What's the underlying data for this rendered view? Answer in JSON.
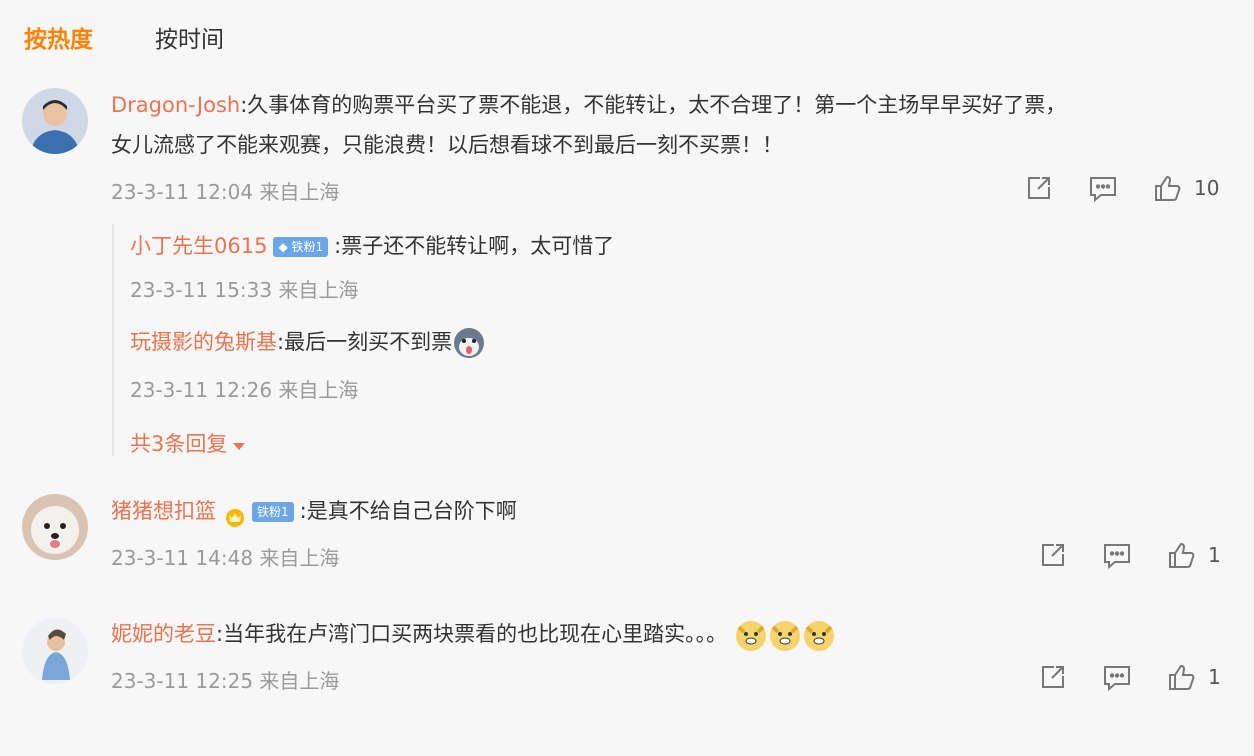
{
  "tabs": {
    "hot": "按热度",
    "time": "按时间"
  },
  "comments": [
    {
      "user": "Dragon-Josh",
      "text_line1": ":久事体育的购票平台买了票不能退，不能转让，太不合理了！第一个主场早早买好了票，",
      "text_line2": "女儿流感了不能来观赛，只能浪费！以后想看球不到最后一刻不买票！！",
      "time": "23-3-11 12:04 来自上海",
      "likes": "10"
    },
    {
      "user": "猪猪想扣篮",
      "badge": "铁粉1",
      "text": ":是真不给自己台阶下啊",
      "time": "23-3-11 14:48 来自上海",
      "likes": "1"
    },
    {
      "user": "妮妮的老豆",
      "text": ":当年我在卢湾门口买两块票看的也比现在心里踏实。。。",
      "emojis": [
        "doge-emoji",
        "doge-emoji",
        "doge-emoji"
      ],
      "time": "23-3-11 12:25 来自上海",
      "likes": "1"
    }
  ],
  "replies": [
    {
      "user": "小丁先生0615",
      "badge": "铁粉1",
      "text": ":票子还不能转让啊，太可惜了",
      "time": "23-3-11 15:33 来自上海"
    },
    {
      "user": "玩摄影的兔斯基",
      "text": ":最后一刻买不到票",
      "time": "23-3-11 12:26 来自上海"
    }
  ],
  "reply_more": "共3条回复",
  "colors": {
    "accent": "#ff8200",
    "username": "#eb7350",
    "meta": "#9a9a9a",
    "badge": "#6aa6e8"
  },
  "icons": [
    "share-icon",
    "comment-icon",
    "like-icon"
  ]
}
